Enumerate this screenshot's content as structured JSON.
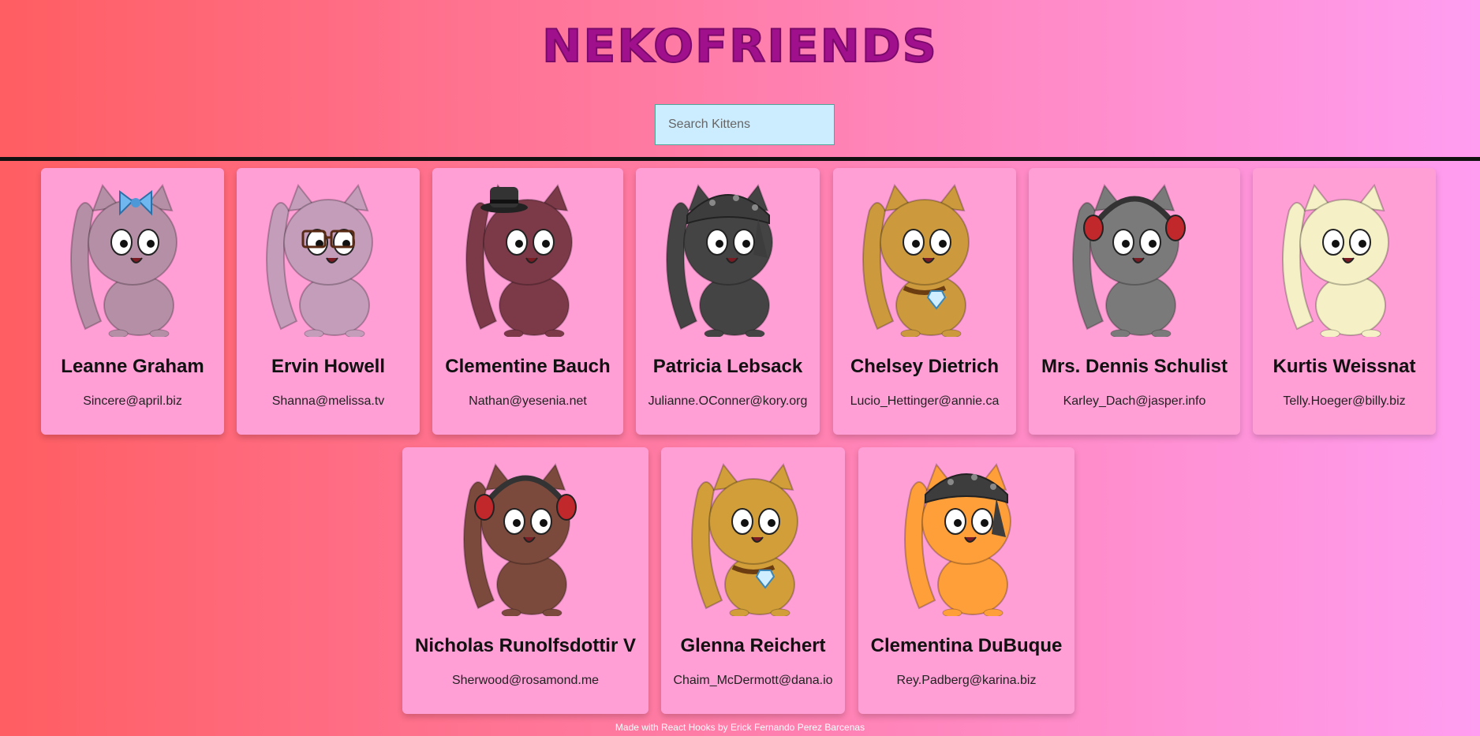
{
  "app": {
    "title": "NEKOFRIENDS"
  },
  "search": {
    "placeholder": "Search Kittens",
    "value": ""
  },
  "cards": [
    {
      "name": "Leanne Graham",
      "email": "Sincere@april.biz",
      "fur": "#b58fa6",
      "accessory": "bow"
    },
    {
      "name": "Ervin Howell",
      "email": "Shanna@melissa.tv",
      "fur": "#c49dbb",
      "accessory": "glasses"
    },
    {
      "name": "Clementine Bauch",
      "email": "Nathan@yesenia.net",
      "fur": "#7c3a48",
      "accessory": "hat"
    },
    {
      "name": "Patricia Lebsack",
      "email": "Julianne.OConner@kory.org",
      "fur": "#444444",
      "accessory": "bandana"
    },
    {
      "name": "Chelsey Dietrich",
      "email": "Lucio_Hettinger@annie.ca",
      "fur": "#cc9a3c",
      "accessory": "collar"
    },
    {
      "name": "Mrs. Dennis Schulist",
      "email": "Karley_Dach@jasper.info",
      "fur": "#7a7a7a",
      "accessory": "headphones"
    },
    {
      "name": "Kurtis Weissnat",
      "email": "Telly.Hoeger@billy.biz",
      "fur": "#f5f0c6",
      "accessory": "none"
    },
    {
      "name": "Nicholas Runolfsdottir V",
      "email": "Sherwood@rosamond.me",
      "fur": "#7b4a3c",
      "accessory": "headphones"
    },
    {
      "name": "Glenna Reichert",
      "email": "Chaim_McDermott@dana.io",
      "fur": "#d19e3a",
      "accessory": "collar"
    },
    {
      "name": "Clementina DuBuque",
      "email": "Rey.Padberg@karina.biz",
      "fur": "#ff9f3a",
      "accessory": "bandana"
    }
  ],
  "footer": {
    "text": "Made with React Hooks by Erick Fernando Perez Barcenas"
  }
}
